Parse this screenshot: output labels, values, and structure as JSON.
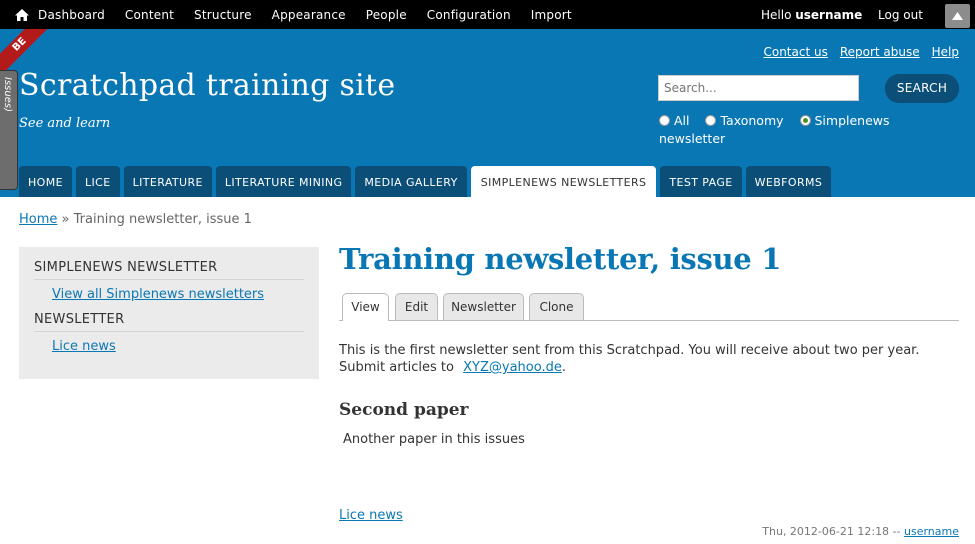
{
  "toolbar": {
    "menu": [
      "Dashboard",
      "Content",
      "Structure",
      "Appearance",
      "People",
      "Configuration",
      "Import"
    ],
    "hello_prefix": "Hello ",
    "username": "username",
    "logout": "Log out"
  },
  "beta_label": "BE",
  "issues_label": "Issues)",
  "header": {
    "top_links": [
      "Contact us",
      "Report abuse",
      "Help"
    ],
    "site_name": "Scratchpad training site",
    "slogan": "See and learn",
    "search_placeholder": "Search...",
    "search_button": "SEARCH",
    "radio_options": [
      "All",
      "Taxonomy",
      "Simplenews newsletter"
    ],
    "radio_selected": "Simplenews newsletter"
  },
  "nav_tabs": [
    "HOME",
    "LICE",
    "LITERATURE",
    "LITERATURE MINING",
    "MEDIA GALLERY",
    "SIMPLENEWS NEWSLETTERS",
    "TEST PAGE",
    "WEBFORMS"
  ],
  "active_tab": "SIMPLENEWS NEWSLETTERS",
  "breadcrumb": {
    "home": "Home",
    "separator": " » ",
    "current": "Training newsletter, issue 1"
  },
  "sidebar": {
    "block1_title": "SIMPLENEWS NEWSLETTER",
    "block1_link": "View all Simplenews newsletters",
    "block2_title": "NEWSLETTER",
    "block2_link": "Lice news"
  },
  "main": {
    "title": "Training newsletter, issue 1",
    "local_tabs": [
      "View",
      "Edit",
      "Newsletter",
      "Clone"
    ],
    "body_text": "This is the first newsletter sent from this Scratchpad. You will receive about two per year. Submit articles to ",
    "email": "XYZ@yahoo.de",
    "body_end": ".",
    "subheading": "Second paper",
    "paragraph": "Another paper in this issues",
    "newsletter_link": "Lice news",
    "submitted_prefix": "Thu, 2012-06-21 12:18 -- ",
    "submitted_user": "username"
  },
  "colors": {
    "header_blue": "#0a77b5",
    "dark_tab": "#0b4e78",
    "toolbar": "#000000"
  }
}
